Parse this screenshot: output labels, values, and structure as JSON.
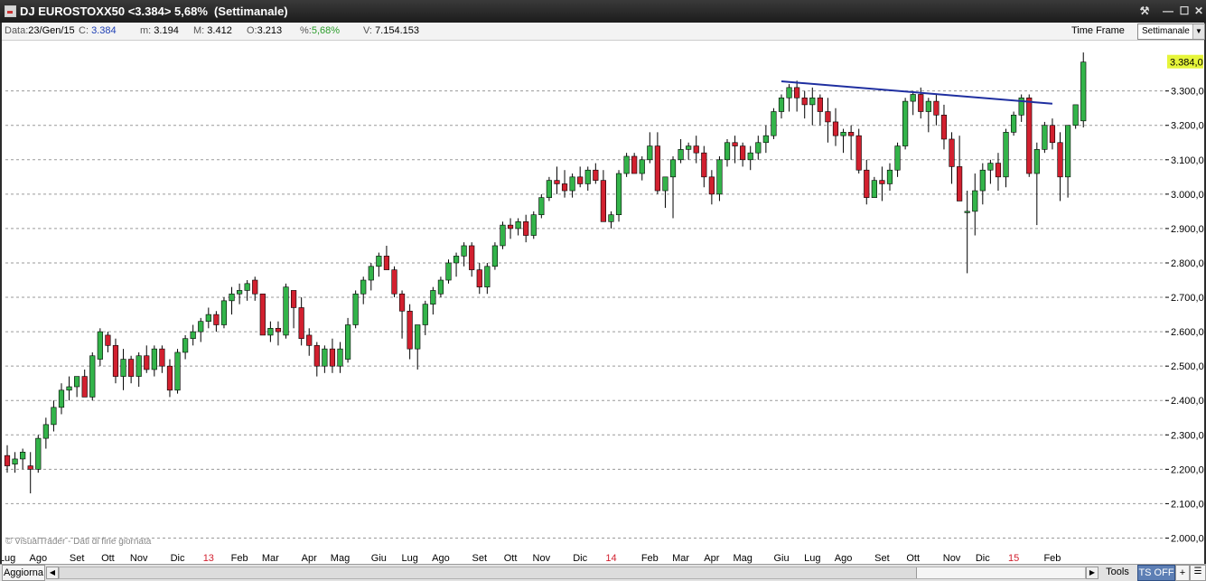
{
  "window": {
    "title": "DJ EUROSTOXX50 <3.384> 5,68%",
    "period": "(Settimanale)",
    "buttons": {
      "tools": "⚒",
      "minimize": "—",
      "maximize": "☐",
      "close": "✕"
    }
  },
  "info": {
    "data_label": "Data:",
    "data_value": "23/Gen/15",
    "close_label": "C:",
    "close_value": "3.384",
    "min_label": "m:",
    "min_value": "3.194",
    "max_label": "M:",
    "max_value": "3.412",
    "open_label": "O:",
    "open_value": "3.213",
    "pct_label": "%:",
    "pct_value": "5,68%",
    "vol_label": "V:",
    "vol_value": "7.154.153",
    "timeframe_label": "Time Frame",
    "timeframe_value": "Settimanale"
  },
  "chart_data": {
    "type": "candlestick",
    "y_ticks": [
      "3.300,0",
      "3.200,0",
      "3.100,0",
      "3.000,0",
      "2.900,0",
      "2.800,0",
      "2.700,0",
      "2.600,0",
      "2.500,0",
      "2.400,0",
      "2.300,0",
      "2.200,0",
      "2.100,0",
      "2.000,0"
    ],
    "y_tick_values": [
      3300,
      3200,
      3100,
      3000,
      2900,
      2800,
      2700,
      2600,
      2500,
      2400,
      2300,
      2200,
      2100,
      2000
    ],
    "ylim": [
      1975,
      3420
    ],
    "last_value_label": "3.384,0",
    "x_labels": [
      {
        "label": "Lug",
        "week": 0,
        "highlight": false
      },
      {
        "label": "Ago",
        "week": 4,
        "highlight": false
      },
      {
        "label": "Set",
        "week": 9,
        "highlight": false
      },
      {
        "label": "Ott",
        "week": 13,
        "highlight": false
      },
      {
        "label": "Nov",
        "week": 17,
        "highlight": false
      },
      {
        "label": "Dic",
        "week": 22,
        "highlight": false
      },
      {
        "label": "13",
        "week": 26,
        "highlight": true
      },
      {
        "label": "Feb",
        "week": 30,
        "highlight": false
      },
      {
        "label": "Mar",
        "week": 34,
        "highlight": false
      },
      {
        "label": "Apr",
        "week": 39,
        "highlight": false
      },
      {
        "label": "Mag",
        "week": 43,
        "highlight": false
      },
      {
        "label": "Giu",
        "week": 48,
        "highlight": false
      },
      {
        "label": "Lug",
        "week": 52,
        "highlight": false
      },
      {
        "label": "Ago",
        "week": 56,
        "highlight": false
      },
      {
        "label": "Set",
        "week": 61,
        "highlight": false
      },
      {
        "label": "Ott",
        "week": 65,
        "highlight": false
      },
      {
        "label": "Nov",
        "week": 69,
        "highlight": false
      },
      {
        "label": "Dic",
        "week": 74,
        "highlight": false
      },
      {
        "label": "14",
        "week": 78,
        "highlight": true
      },
      {
        "label": "Feb",
        "week": 83,
        "highlight": false
      },
      {
        "label": "Mar",
        "week": 87,
        "highlight": false
      },
      {
        "label": "Apr",
        "week": 91,
        "highlight": false
      },
      {
        "label": "Mag",
        "week": 95,
        "highlight": false
      },
      {
        "label": "Giu",
        "week": 100,
        "highlight": false
      },
      {
        "label": "Lug",
        "week": 104,
        "highlight": false
      },
      {
        "label": "Ago",
        "week": 108,
        "highlight": false
      },
      {
        "label": "Set",
        "week": 113,
        "highlight": false
      },
      {
        "label": "Ott",
        "week": 117,
        "highlight": false
      },
      {
        "label": "Nov",
        "week": 122,
        "highlight": false
      },
      {
        "label": "Dic",
        "week": 126,
        "highlight": false
      },
      {
        "label": "15",
        "week": 130,
        "highlight": true
      },
      {
        "label": "Feb",
        "week": 135,
        "highlight": false
      }
    ],
    "trendline": {
      "from": {
        "week": 100,
        "value": 3328
      },
      "to": {
        "week": 135,
        "value": 3263
      }
    },
    "candles": [
      [
        2240,
        2270,
        2190,
        2210
      ],
      [
        2215,
        2250,
        2190,
        2230
      ],
      [
        2230,
        2260,
        2200,
        2250
      ],
      [
        2210,
        2250,
        2130,
        2200
      ],
      [
        2200,
        2300,
        2190,
        2290
      ],
      [
        2290,
        2350,
        2260,
        2330
      ],
      [
        2330,
        2400,
        2310,
        2380
      ],
      [
        2380,
        2450,
        2360,
        2430
      ],
      [
        2430,
        2470,
        2400,
        2440
      ],
      [
        2440,
        2460,
        2410,
        2470
      ],
      [
        2470,
        2490,
        2420,
        2410
      ],
      [
        2410,
        2540,
        2400,
        2530
      ],
      [
        2520,
        2610,
        2500,
        2600
      ],
      [
        2590,
        2600,
        2540,
        2560
      ],
      [
        2560,
        2580,
        2450,
        2470
      ],
      [
        2470,
        2550,
        2430,
        2520
      ],
      [
        2520,
        2530,
        2450,
        2470
      ],
      [
        2470,
        2540,
        2440,
        2530
      ],
      [
        2530,
        2560,
        2480,
        2490
      ],
      [
        2490,
        2560,
        2470,
        2550
      ],
      [
        2550,
        2560,
        2480,
        2500
      ],
      [
        2500,
        2520,
        2410,
        2430
      ],
      [
        2430,
        2550,
        2420,
        2540
      ],
      [
        2540,
        2590,
        2520,
        2580
      ],
      [
        2580,
        2620,
        2560,
        2600
      ],
      [
        2600,
        2640,
        2570,
        2630
      ],
      [
        2630,
        2670,
        2610,
        2650
      ],
      [
        2650,
        2660,
        2600,
        2620
      ],
      [
        2620,
        2700,
        2610,
        2690
      ],
      [
        2690,
        2730,
        2650,
        2710
      ],
      [
        2710,
        2740,
        2680,
        2720
      ],
      [
        2720,
        2750,
        2690,
        2740
      ],
      [
        2750,
        2760,
        2690,
        2710
      ],
      [
        2710,
        2710,
        2600,
        2590
      ],
      [
        2590,
        2630,
        2570,
        2610
      ],
      [
        2610,
        2630,
        2560,
        2600
      ],
      [
        2590,
        2740,
        2580,
        2730
      ],
      [
        2720,
        2720,
        2610,
        2670
      ],
      [
        2670,
        2700,
        2560,
        2580
      ],
      [
        2590,
        2610,
        2530,
        2560
      ],
      [
        2560,
        2570,
        2470,
        2500
      ],
      [
        2500,
        2560,
        2480,
        2550
      ],
      [
        2550,
        2580,
        2480,
        2500
      ],
      [
        2500,
        2570,
        2480,
        2550
      ],
      [
        2520,
        2640,
        2510,
        2620
      ],
      [
        2620,
        2720,
        2610,
        2710
      ],
      [
        2710,
        2760,
        2680,
        2750
      ],
      [
        2750,
        2800,
        2720,
        2790
      ],
      [
        2790,
        2830,
        2760,
        2820
      ],
      [
        2820,
        2850,
        2790,
        2780
      ],
      [
        2780,
        2790,
        2700,
        2710
      ],
      [
        2710,
        2720,
        2580,
        2660
      ],
      [
        2660,
        2680,
        2520,
        2550
      ],
      [
        2550,
        2620,
        2490,
        2620
      ],
      [
        2620,
        2690,
        2590,
        2680
      ],
      [
        2680,
        2730,
        2650,
        2720
      ],
      [
        2710,
        2760,
        2700,
        2750
      ],
      [
        2750,
        2810,
        2740,
        2800
      ],
      [
        2800,
        2830,
        2760,
        2820
      ],
      [
        2820,
        2860,
        2790,
        2850
      ],
      [
        2850,
        2860,
        2760,
        2780
      ],
      [
        2780,
        2800,
        2710,
        2730
      ],
      [
        2730,
        2800,
        2710,
        2790
      ],
      [
        2790,
        2860,
        2780,
        2850
      ],
      [
        2850,
        2920,
        2840,
        2910
      ],
      [
        2910,
        2930,
        2870,
        2900
      ],
      [
        2900,
        2930,
        2880,
        2920
      ],
      [
        2920,
        2940,
        2860,
        2880
      ],
      [
        2880,
        2950,
        2870,
        2940
      ],
      [
        2940,
        3000,
        2930,
        2990
      ],
      [
        2990,
        3050,
        2980,
        3040
      ],
      [
        3040,
        3080,
        3000,
        3030
      ],
      [
        3030,
        3070,
        2990,
        3010
      ],
      [
        3010,
        3060,
        2990,
        3050
      ],
      [
        3050,
        3080,
        3020,
        3030
      ],
      [
        3030,
        3080,
        3010,
        3070
      ],
      [
        3070,
        3090,
        3030,
        3040
      ],
      [
        3040,
        3070,
        2930,
        2920
      ],
      [
        2920,
        2950,
        2900,
        2940
      ],
      [
        2940,
        3070,
        2920,
        3060
      ],
      [
        3060,
        3120,
        3050,
        3110
      ],
      [
        3110,
        3120,
        3070,
        3060
      ],
      [
        3060,
        3110,
        3040,
        3100
      ],
      [
        3100,
        3180,
        3090,
        3140
      ],
      [
        3140,
        3180,
        3000,
        3010
      ],
      [
        3010,
        3040,
        2960,
        3050
      ],
      [
        3050,
        3110,
        2930,
        3100
      ],
      [
        3100,
        3160,
        3090,
        3130
      ],
      [
        3130,
        3150,
        3100,
        3140
      ],
      [
        3140,
        3170,
        3090,
        3120
      ],
      [
        3120,
        3140,
        3020,
        3050
      ],
      [
        3050,
        3070,
        2970,
        3000
      ],
      [
        3000,
        3110,
        2980,
        3100
      ],
      [
        3100,
        3160,
        3080,
        3150
      ],
      [
        3150,
        3170,
        3090,
        3140
      ],
      [
        3140,
        3150,
        3080,
        3100
      ],
      [
        3100,
        3140,
        3070,
        3120
      ],
      [
        3120,
        3170,
        3100,
        3150
      ],
      [
        3150,
        3200,
        3120,
        3170
      ],
      [
        3170,
        3250,
        3160,
        3240
      ],
      [
        3240,
        3290,
        3220,
        3280
      ],
      [
        3280,
        3320,
        3240,
        3310
      ],
      [
        3310,
        3330,
        3240,
        3280
      ],
      [
        3280,
        3300,
        3220,
        3260
      ],
      [
        3260,
        3310,
        3200,
        3280
      ],
      [
        3280,
        3290,
        3200,
        3240
      ],
      [
        3240,
        3280,
        3150,
        3210
      ],
      [
        3210,
        3250,
        3140,
        3170
      ],
      [
        3170,
        3190,
        3120,
        3180
      ],
      [
        3180,
        3200,
        3100,
        3170
      ],
      [
        3170,
        3190,
        3060,
        3070
      ],
      [
        3070,
        3100,
        2970,
        2990
      ],
      [
        2990,
        3050,
        2990,
        3040
      ],
      [
        3040,
        3080,
        2980,
        3030
      ],
      [
        3030,
        3090,
        3010,
        3070
      ],
      [
        3070,
        3150,
        3050,
        3140
      ],
      [
        3140,
        3280,
        3130,
        3270
      ],
      [
        3270,
        3300,
        3230,
        3290
      ],
      [
        3290,
        3310,
        3220,
        3240
      ],
      [
        3240,
        3280,
        3180,
        3270
      ],
      [
        3270,
        3290,
        3200,
        3230
      ],
      [
        3230,
        3260,
        3130,
        3160
      ],
      [
        3160,
        3180,
        3030,
        3080
      ],
      [
        3080,
        3170,
        3000,
        2980
      ],
      [
        2950,
        3010,
        2770,
        2950
      ],
      [
        2950,
        3060,
        2880,
        3010
      ],
      [
        3010,
        3090,
        2970,
        3070
      ],
      [
        3070,
        3100,
        3030,
        3090
      ],
      [
        3090,
        3120,
        3010,
        3050
      ],
      [
        3050,
        3190,
        3020,
        3180
      ],
      [
        3180,
        3240,
        3170,
        3230
      ],
      [
        3230,
        3290,
        3210,
        3280
      ],
      [
        3280,
        3290,
        3050,
        3060
      ],
      [
        3060,
        3150,
        2910,
        3130
      ],
      [
        3130,
        3210,
        3120,
        3200
      ],
      [
        3200,
        3220,
        3130,
        3150
      ],
      [
        3150,
        3180,
        2980,
        3050
      ],
      [
        3050,
        3100,
        2990,
        3200
      ],
      [
        3200,
        3230,
        3190,
        3260
      ],
      [
        3213,
        3412,
        3194,
        3384
      ]
    ]
  },
  "footer": {
    "watermark": "© VisualTrader - Dati di fine giornata"
  },
  "bottombar": {
    "refresh": "Aggiorna",
    "tools": "Tools",
    "ts": "TS OFF",
    "plus": "+",
    "menu": "☰"
  },
  "colors": {
    "up": "#33b44a",
    "down": "#d2202f",
    "trendline": "#1f2fa0",
    "grid": "#9a9a9a",
    "price_tag": "#e6f53a"
  }
}
